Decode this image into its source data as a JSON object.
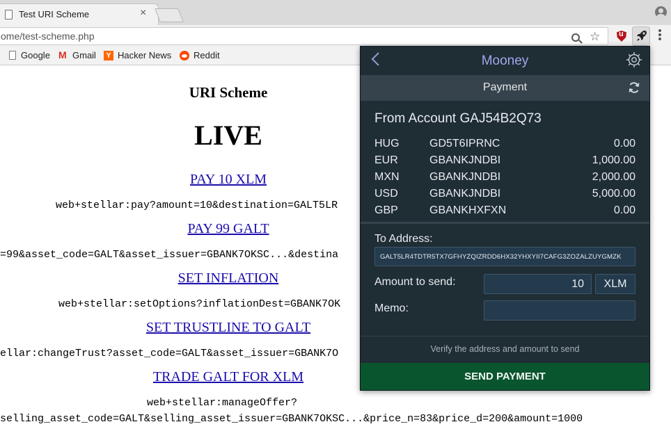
{
  "browser": {
    "tab_title": "Test URI Scheme",
    "tab_close": "×",
    "url": "ome/test-scheme.php",
    "bookmarks": [
      "Google",
      "Gmail",
      "Hacker News",
      "Reddit"
    ],
    "hn_glyph": "Y",
    "gmail_glyph": "M"
  },
  "page": {
    "title": "URI Scheme",
    "heading": "LIVE",
    "links": [
      {
        "label": "PAY 10 XLM",
        "uri": "web+stellar:pay?amount=10&destination=GALT5LR"
      },
      {
        "label": "PAY 99 GALT",
        "uri": "=99&asset_code=GALT&asset_issuer=GBANK7OKSC...&destina"
      },
      {
        "label": "SET INFLATION",
        "uri": "web+stellar:setOptions?inflationDest=GBANK7OK"
      },
      {
        "label": "SET TRUSTLINE TO GALT",
        "uri": "ellar:changeTrust?asset_code=GALT&asset_issuer=GBANK7O"
      },
      {
        "label": "TRADE GALT FOR XLM",
        "uri": "web+stellar:manageOffer?",
        "uri_line2": "selling_asset_code=GALT&selling_asset_issuer=GBANK7OKSC...&price_n=83&price_d=200&amount=1000"
      }
    ]
  },
  "popup": {
    "app_title": "Mooney",
    "subtitle": "Payment",
    "from_account": "From Account GAJ54B2Q73",
    "balances": [
      {
        "code": "HUG",
        "issuer": "GD5T6IPRNC",
        "amount": "0.00"
      },
      {
        "code": "EUR",
        "issuer": "GBANKJNDBI",
        "amount": "1,000.00"
      },
      {
        "code": "MXN",
        "issuer": "GBANKJNDBI",
        "amount": "2,000.00"
      },
      {
        "code": "USD",
        "issuer": "GBANKJNDBI",
        "amount": "5,000.00"
      },
      {
        "code": "GBP",
        "issuer": "GBANKHXFXN",
        "amount": "0.00"
      }
    ],
    "to_address_label": "To Address:",
    "to_address_value": "GALT5LR4TDTR5TX7GFHYZQIZRDD6HX32YHXYII7CAFG3ZOZALZUYGMZK",
    "amount_label": "Amount to send:",
    "amount_value": "10",
    "amount_unit": "XLM",
    "memo_label": "Memo:",
    "memo_value": "",
    "hint": "Verify the address and amount to send",
    "send_label": "SEND PAYMENT",
    "colors": {
      "background": "#1f2d35",
      "accent_title": "#a3a6ea",
      "send_button": "#09552d"
    }
  }
}
